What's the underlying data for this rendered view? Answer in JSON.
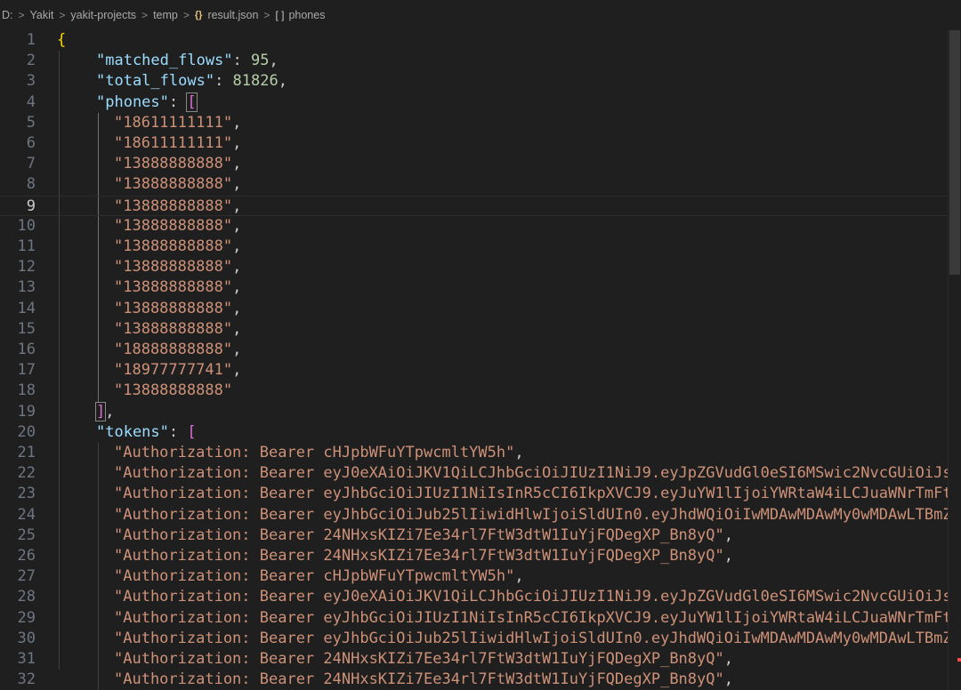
{
  "breadcrumb": {
    "drive": "D:",
    "folder1": "Yakit",
    "folder2": "yakit-projects",
    "folder3": "temp",
    "file": "result.json",
    "file_icon": "{}",
    "symbol": "phones",
    "symbol_icon": "[ ]",
    "separator": ">"
  },
  "editor": {
    "active_line": 9,
    "line_numbers": [
      "1",
      "2",
      "3",
      "4",
      "5",
      "6",
      "7",
      "8",
      "9",
      "10",
      "11",
      "12",
      "13",
      "14",
      "15",
      "16",
      "17",
      "18",
      "19",
      "20",
      "21",
      "22",
      "23",
      "24",
      "25",
      "26",
      "27",
      "28",
      "29",
      "30",
      "31",
      "32"
    ],
    "keys": {
      "matched_flows": "\"matched_flows\"",
      "total_flows": "\"total_flows\"",
      "phones": "\"phones\"",
      "tokens": "\"tokens\""
    },
    "values": {
      "matched_flows": "95",
      "total_flows": "81826"
    },
    "phones": [
      "\"18611111111\"",
      "\"18611111111\"",
      "\"13888888888\"",
      "\"13888888888\"",
      "\"13888888888\"",
      "\"13888888888\"",
      "\"13888888888\"",
      "\"13888888888\"",
      "\"13888888888\"",
      "\"13888888888\"",
      "\"13888888888\"",
      "\"18888888888\"",
      "\"18977777741\"",
      "\"13888888888\""
    ],
    "tokens": [
      "\"Authorization: Bearer cHJpbWFuYTpwcmltYW5h\"",
      "\"Authorization: Bearer eyJ0eXAiOiJKV1QiLCJhbGciOiJIUzI1NiJ9.eyJpZGVudGl0eSI6MSwic2NvcGUiOiJs",
      "\"Authorization: Bearer eyJhbGciOiJIUzI1NiIsInR5cCI6IkpXVCJ9.eyJuYW1lIjoiYWRtaW4iLCJuaWNrTmFt",
      "\"Authorization: Bearer eyJhbGciOiJub25lIiwidHlwIjoiSldUIn0.eyJhdWQiOiIwMDAwMDAwMy0wMDAwLTBmZ",
      "\"Authorization: Bearer 24NHxsKIZi7Ee34rl7FtW3dtW1IuYjFQDegXP_Bn8yQ\"",
      "\"Authorization: Bearer 24NHxsKIZi7Ee34rl7FtW3dtW1IuYjFQDegXP_Bn8yQ\"",
      "\"Authorization: Bearer cHJpbWFuYTpwcmltYW5h\"",
      "\"Authorization: Bearer eyJ0eXAiOiJKV1QiLCJhbGciOiJIUzI1NiJ9.eyJpZGVudGl0eSI6MSwic2NvcGUiOiJs",
      "\"Authorization: Bearer eyJhbGciOiJIUzI1NiIsInR5cCI6IkpXVCJ9.eyJuYW1lIjoiYWRtaW4iLCJuaWNrTmFt",
      "\"Authorization: Bearer eyJhbGciOiJub25lIiwidHlwIjoiSldUIn0.eyJhdWQiOiIwMDAwMDAwMy0wMDAwLTBmZ",
      "\"Authorization: Bearer 24NHxsKIZi7Ee34rl7FtW3dtW1IuYjFQDegXP_Bn8yQ\"",
      "\"Authorization: Bearer 24NHxsKIZi7Ee34rl7FtW3dtW1IuYjFQDegXP_Bn8yQ\""
    ],
    "token_line_endings": [
      ",",
      "",
      "",
      "",
      ",",
      ",",
      ",",
      "",
      "",
      "",
      ",",
      ","
    ],
    "colors": {
      "background": "#1f1f1f",
      "key": "#9cdcfe",
      "string": "#ce9178",
      "number": "#b5cea8",
      "bracket_level1": "#ffd700",
      "bracket_level2": "#da70d6",
      "line_number": "#6e7681",
      "line_number_active": "#cccccc"
    }
  }
}
